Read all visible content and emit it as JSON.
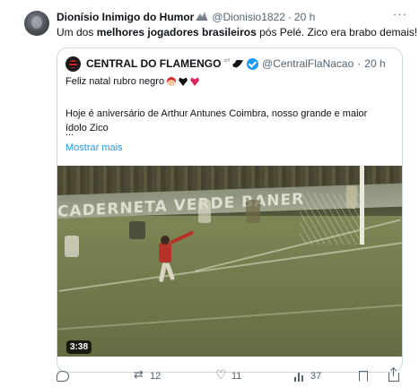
{
  "tweet": {
    "author_name": "Dionísio Inimigo do Humor",
    "author_emoji": "mountain-emoji",
    "handle": "@Dionisio1822",
    "separator": "·",
    "time": "20 h",
    "more_icon": "more-horizontal-icon",
    "more_label": "···",
    "text_parts": [
      "Um dos ",
      "melhores jogadores brasileiros",
      " pós Pelé. Zico era brabo demais!"
    ]
  },
  "quote": {
    "author_name": "CENTRAL DO FLAMENGO",
    "author_badges": "ᶜʳᶠ",
    "bird_icon": "bird-icon",
    "verified_icon": "verified-badge-icon",
    "handle": "@CentralFlaNacao",
    "separator": "·",
    "time": "20 h",
    "line1": "Feliz natal rubro negro",
    "line1_emojis": [
      "santa-emoji",
      "black-heart-emoji",
      "red-heart-emoji"
    ],
    "line2": "Hoje é aniversário de Arthur Antunes Coimbra, nosso grande e maior",
    "line3": "ídolo Zico",
    "line4": "...",
    "show_more": "Mostrar mais",
    "video": {
      "board_text": "CADERNETA VERDE BANER",
      "duration": "3:38"
    }
  },
  "actions": {
    "reply": {
      "icon": "reply-icon",
      "count": ""
    },
    "retweet": {
      "icon": "retweet-icon",
      "count": "12"
    },
    "like": {
      "icon": "heart-icon",
      "count": "11"
    },
    "views": {
      "icon": "views-icon",
      "count": "37"
    },
    "bookmark": {
      "icon": "bookmark-icon"
    },
    "share": {
      "icon": "share-icon"
    }
  },
  "colors": {
    "text": "#0f1419",
    "secondary": "#536471",
    "link": "#1d9bf0",
    "border": "#cfd9de",
    "verified": "#1d9bf0"
  }
}
